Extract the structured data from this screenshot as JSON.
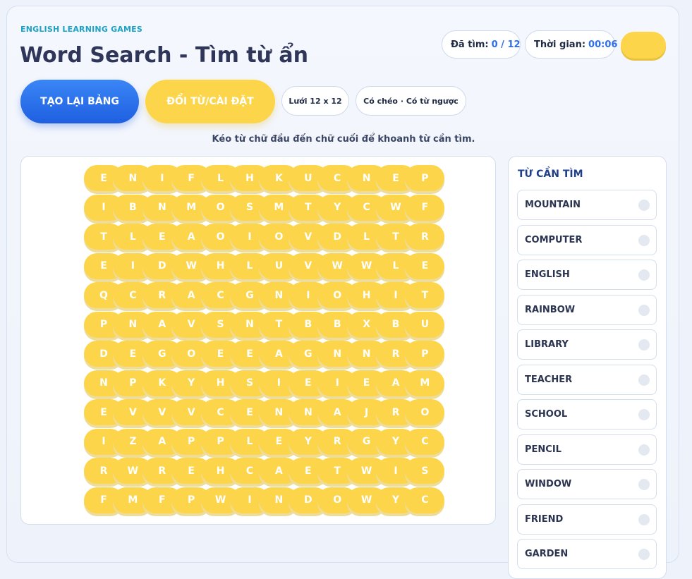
{
  "header": {
    "eyebrow": "ENGLISH LEARNING GAMES",
    "title": "Word Search - Tìm từ ẩn"
  },
  "stats": {
    "found_label": "Đã tìm:",
    "found_value": "0 / 12",
    "time_label": "Thời gian:",
    "time_value": "00:06"
  },
  "toolbar": {
    "regen_label": "TẠO LẠI BẢNG",
    "settings_label": "ĐỔI TỪ/CÀI ĐẶT",
    "grid_chip": "Lưới 12 x 12",
    "mode_chip": "Có chéo · Có từ ngược"
  },
  "instruction": "Kéo từ chữ đầu đến chữ cuối để khoanh từ cần tìm.",
  "colors": {
    "accent_blue": "#2f6fea",
    "tile_yellow": "#fcd54a",
    "brand_cyan": "#1aa3c9"
  },
  "grid": [
    [
      "E",
      "N",
      "I",
      "F",
      "L",
      "H",
      "K",
      "U",
      "C",
      "N",
      "E",
      "P"
    ],
    [
      "I",
      "B",
      "N",
      "M",
      "O",
      "S",
      "M",
      "T",
      "Y",
      "C",
      "W",
      "F"
    ],
    [
      "T",
      "L",
      "E",
      "A",
      "O",
      "I",
      "O",
      "V",
      "D",
      "L",
      "T",
      "R"
    ],
    [
      "E",
      "I",
      "D",
      "W",
      "H",
      "L",
      "U",
      "V",
      "W",
      "W",
      "L",
      "E"
    ],
    [
      "Q",
      "C",
      "R",
      "A",
      "C",
      "G",
      "N",
      "I",
      "O",
      "H",
      "I",
      "T"
    ],
    [
      "P",
      "N",
      "A",
      "V",
      "S",
      "N",
      "T",
      "B",
      "B",
      "X",
      "B",
      "U"
    ],
    [
      "D",
      "E",
      "G",
      "O",
      "E",
      "E",
      "A",
      "G",
      "N",
      "N",
      "R",
      "P"
    ],
    [
      "N",
      "P",
      "K",
      "Y",
      "H",
      "S",
      "I",
      "E",
      "I",
      "E",
      "A",
      "M"
    ],
    [
      "E",
      "V",
      "V",
      "V",
      "C",
      "E",
      "N",
      "N",
      "A",
      "J",
      "R",
      "O"
    ],
    [
      "I",
      "Z",
      "A",
      "P",
      "P",
      "L",
      "E",
      "Y",
      "R",
      "G",
      "Y",
      "C"
    ],
    [
      "R",
      "W",
      "R",
      "E",
      "H",
      "C",
      "A",
      "E",
      "T",
      "W",
      "I",
      "S"
    ],
    [
      "F",
      "M",
      "F",
      "P",
      "W",
      "I",
      "N",
      "D",
      "O",
      "W",
      "Y",
      "C"
    ]
  ],
  "sidebar": {
    "title": "TỪ CẦN TÌM",
    "words": [
      "MOUNTAIN",
      "COMPUTER",
      "ENGLISH",
      "RAINBOW",
      "LIBRARY",
      "TEACHER",
      "SCHOOL",
      "PENCIL",
      "WINDOW",
      "FRIEND",
      "GARDEN"
    ]
  }
}
